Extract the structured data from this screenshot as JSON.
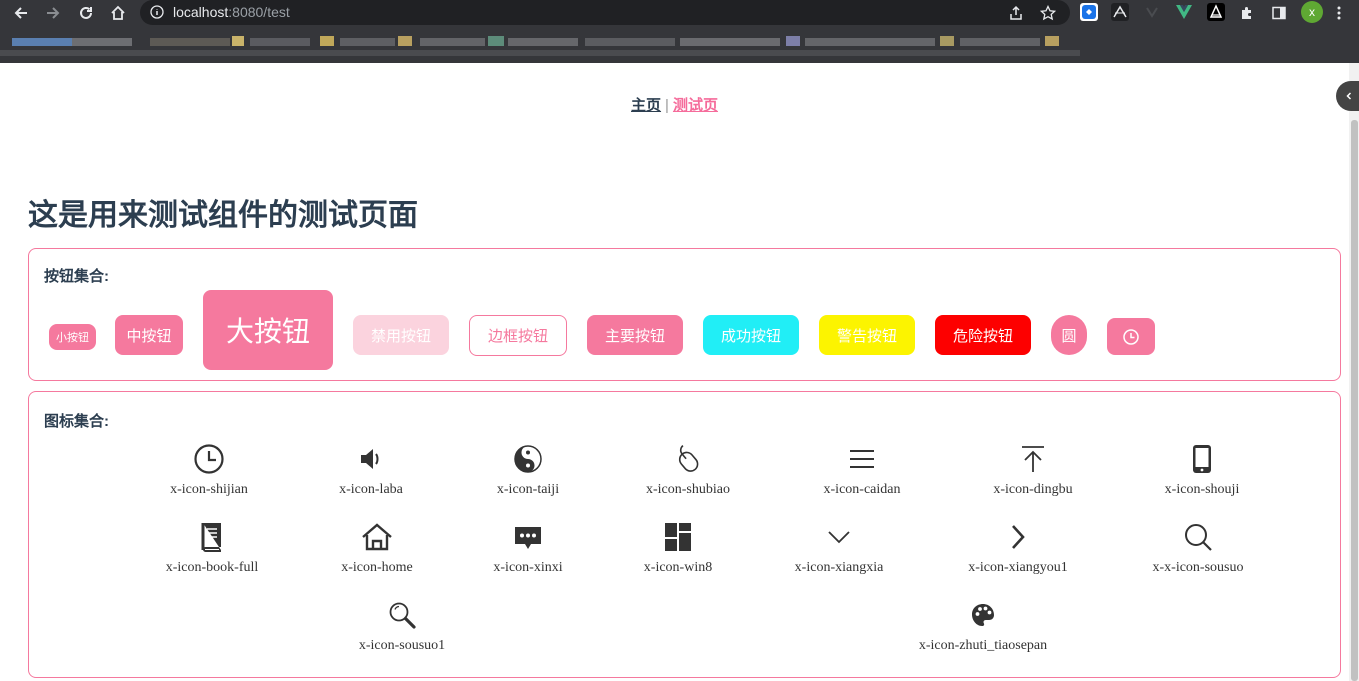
{
  "browser": {
    "url_host": "localhost",
    "url_path": ":8080/test",
    "profile_initial": "x"
  },
  "nav": {
    "home_label": "主页",
    "separator": "|",
    "test_label": "测试页"
  },
  "page": {
    "title": "这是用来测试组件的测试页面"
  },
  "buttons_panel": {
    "title": "按钮集合:",
    "small": "小按钮",
    "medium": "中按钮",
    "large": "大按钮",
    "disabled": "禁用按钮",
    "border": "边框按钮",
    "primary": "主要按钮",
    "success": "成功按钮",
    "warning": "警告按钮",
    "danger": "危险按钮",
    "round": "圆"
  },
  "icons_panel": {
    "title": "图标集合:",
    "icons": [
      "x-icon-shijian",
      "x-icon-laba",
      "x-icon-taiji",
      "x-icon-shubiao",
      "x-icon-caidan",
      "x-icon-dingbu",
      "x-icon-shouji",
      "x-icon-book-full",
      "x-icon-home",
      "x-icon-xinxi",
      "x-icon-win8",
      "x-icon-xiangxia",
      "x-icon-xiangyou1",
      "x-x-icon-sousuo",
      "x-icon-sousuo1",
      "x-icon-zhuti_tiaosepan"
    ]
  },
  "colors": {
    "brand_pink": "#f5799e",
    "success": "#21eef6",
    "warning": "#fcf400",
    "danger": "#fd0000",
    "disabled": "#fbd3de",
    "heading": "#2c3e50"
  }
}
